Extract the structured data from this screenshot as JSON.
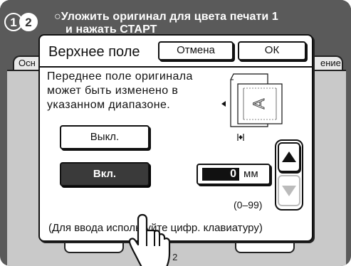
{
  "header": {
    "badge_1": "1",
    "badge_2": "2",
    "line1": "Уложить оригинал для цвета печати 1",
    "line2": "и нажать СТАРТ"
  },
  "background": {
    "tab_left": "Осн",
    "tab_right": "ение",
    "page": "1 / 2"
  },
  "dialog": {
    "title": "Верхнее поле",
    "cancel_label": "Отмена",
    "ok_label": "ОК",
    "description": [
      "Переднее поле оригинала",
      "может быть изменено в",
      "указанном диапазоне."
    ],
    "diagram_letter": "A",
    "off_label": "Выкл.",
    "on_label": "Вкл.",
    "selected": "on",
    "value": "0",
    "unit": "мм",
    "range": "(0–99)",
    "hint": "(Для ввода используйте цифр. клавиатуру)"
  },
  "icons": {
    "up": "arrow-up-icon",
    "down": "arrow-down-icon",
    "hand": "pointing-hand-icon",
    "diagram": "paper-margin-diagram-icon"
  },
  "colors": {
    "screen_bg": "#5a5a5a",
    "selected_button": "#3a3a3a",
    "panel_bg": "#c9c9c9"
  }
}
